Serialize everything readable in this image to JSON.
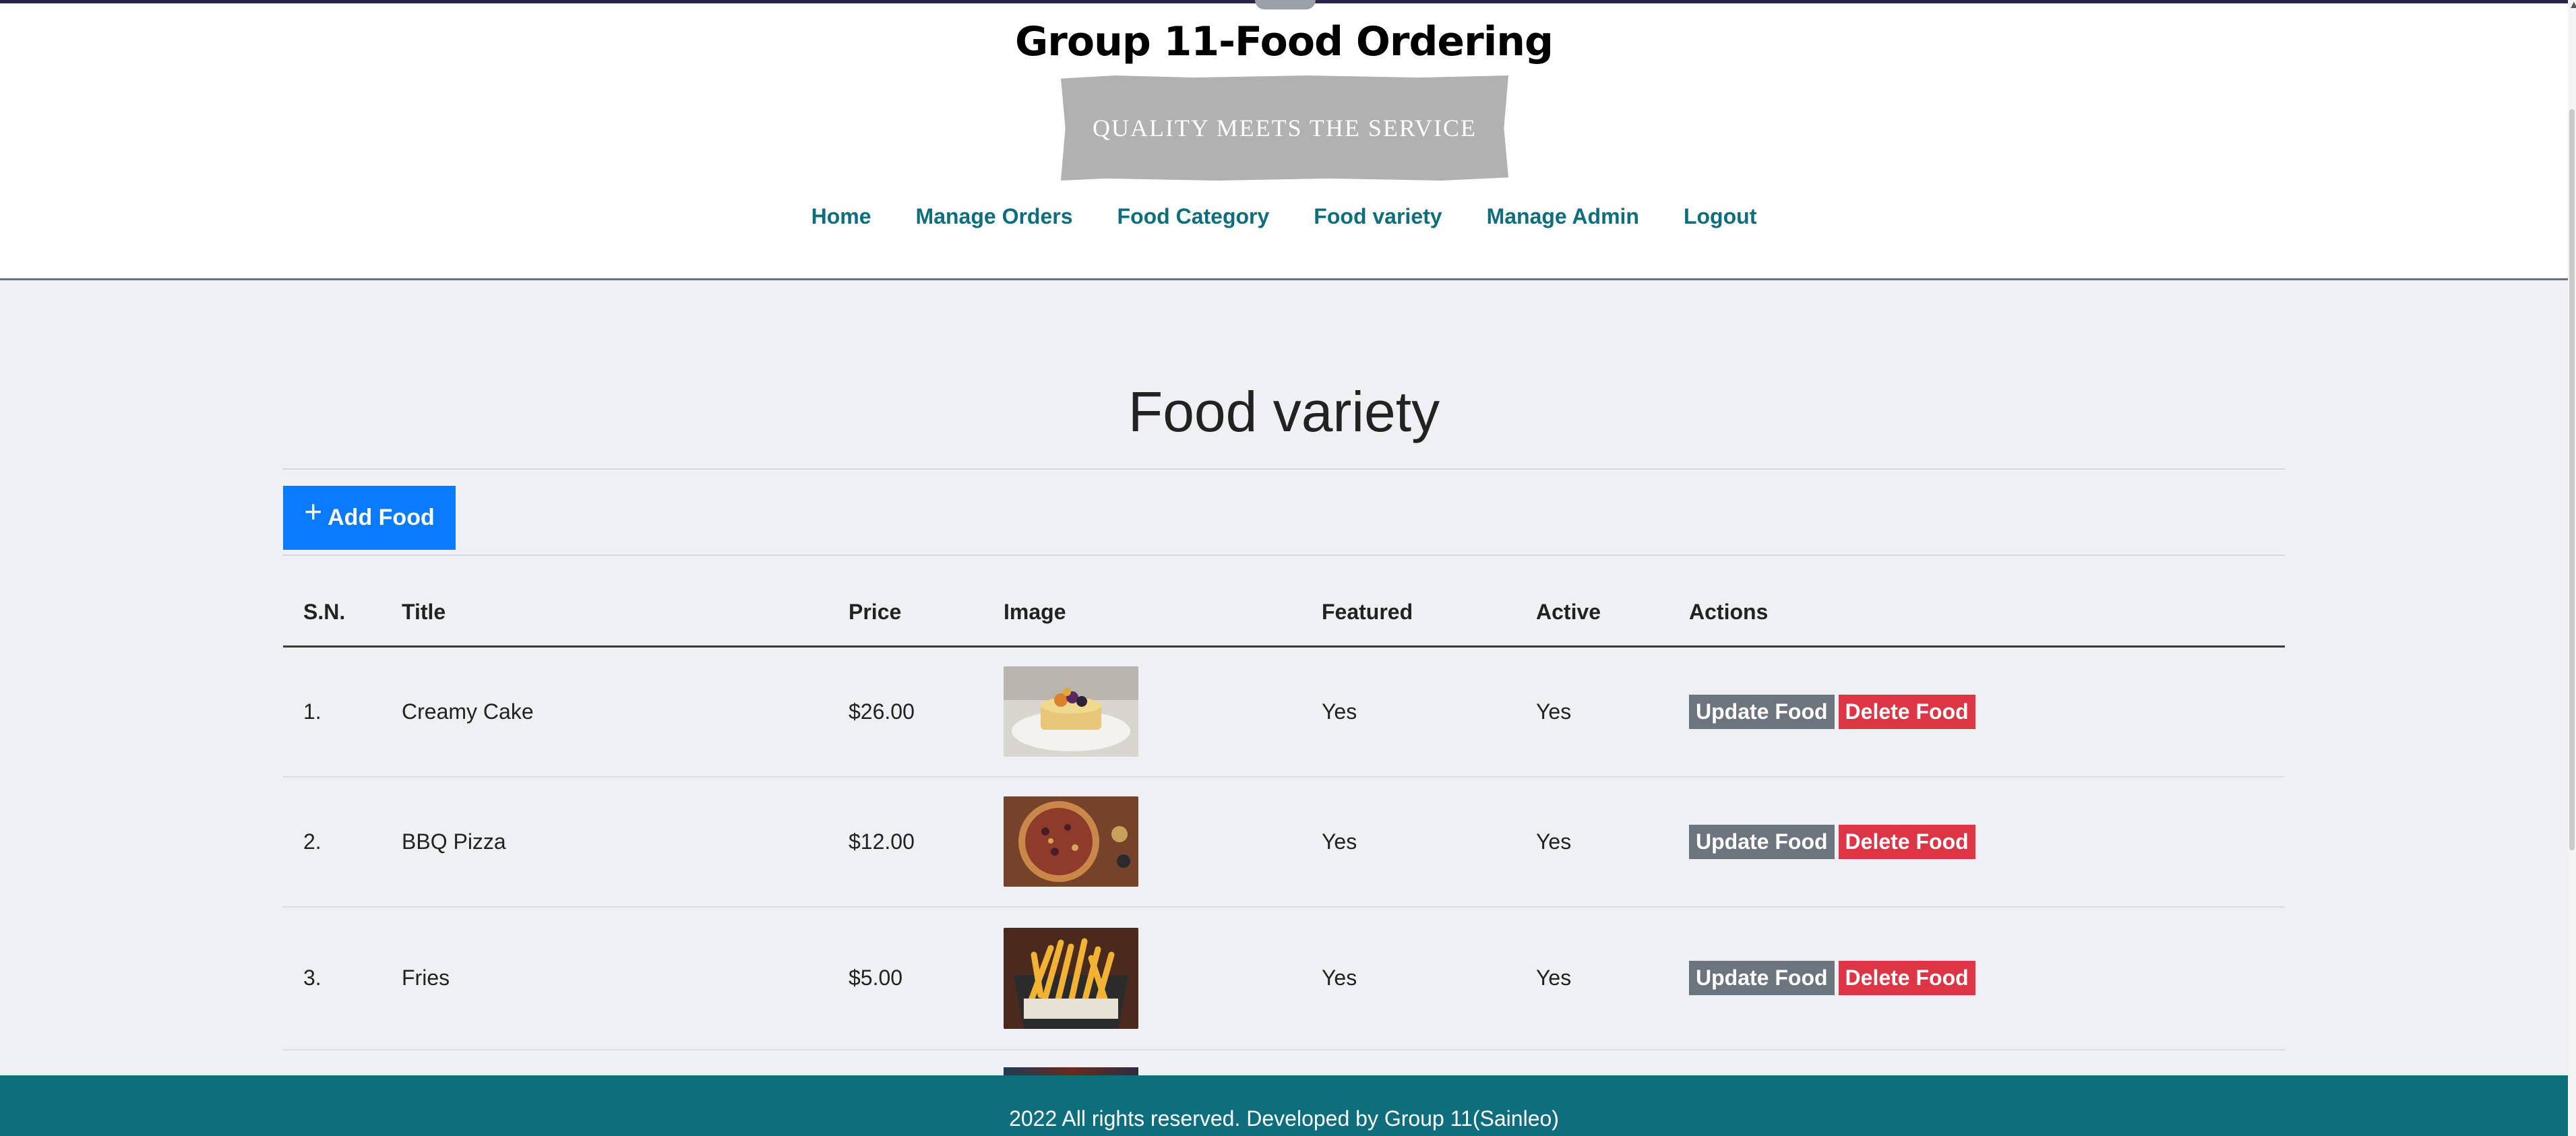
{
  "header": {
    "title": "Group 11-Food Ordering",
    "tagline": "QUALITY MEETS THE SERVICE"
  },
  "nav": {
    "items": [
      "Home",
      "Manage Orders",
      "Food Category",
      "Food variety",
      "Manage Admin",
      "Logout"
    ]
  },
  "main": {
    "title": "Food variety",
    "add_button_label": "Add Food",
    "add_button_icon": "plus-icon",
    "columns": [
      "S.N.",
      "Title",
      "Price",
      "Image",
      "Featured",
      "Active",
      "Actions"
    ],
    "rows": [
      {
        "sn": "1.",
        "title": "Creamy Cake",
        "price": "$26.00",
        "image": "creamy-cake-photo",
        "featured": "Yes",
        "active": "Yes"
      },
      {
        "sn": "2.",
        "title": "BBQ Pizza",
        "price": "$12.00",
        "image": "bbq-pizza-photo",
        "featured": "Yes",
        "active": "Yes"
      },
      {
        "sn": "3.",
        "title": "Fries",
        "price": "$5.00",
        "image": "fries-photo",
        "featured": "Yes",
        "active": "Yes"
      }
    ],
    "update_label": "Update Food",
    "delete_label": "Delete Food"
  },
  "footer": {
    "text": "2022 All rights reserved. Developed by Group 11(Sainleo)"
  },
  "colors": {
    "nav_link": "#0e6e7e",
    "footer_bg": "#0e6e7e",
    "add_button": "#0a7bff",
    "update_button": "#6c757d",
    "delete_button": "#dc3545",
    "page_bg": "#eff0f4"
  }
}
